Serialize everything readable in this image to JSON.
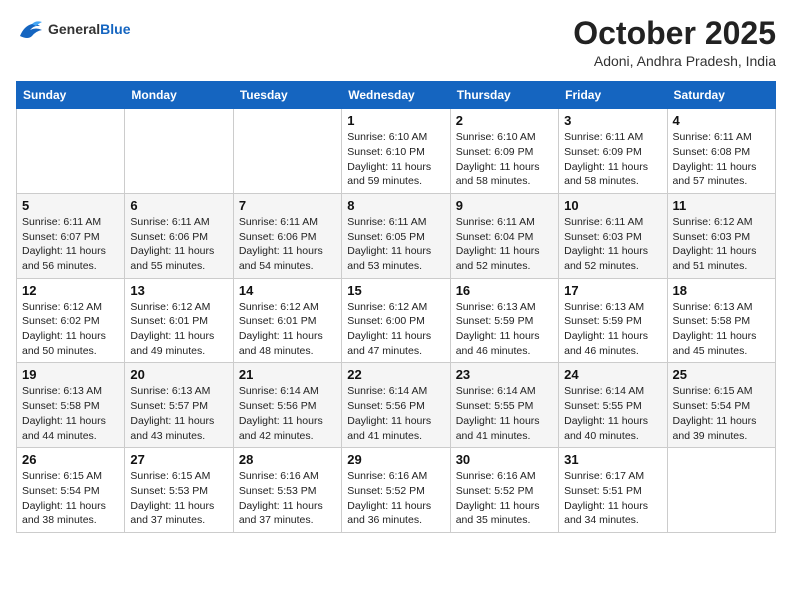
{
  "header": {
    "logo_general": "General",
    "logo_blue": "Blue",
    "month": "October 2025",
    "location": "Adoni, Andhra Pradesh, India"
  },
  "weekdays": [
    "Sunday",
    "Monday",
    "Tuesday",
    "Wednesday",
    "Thursday",
    "Friday",
    "Saturday"
  ],
  "weeks": [
    [
      {
        "day": "",
        "info": ""
      },
      {
        "day": "",
        "info": ""
      },
      {
        "day": "",
        "info": ""
      },
      {
        "day": "1",
        "info": "Sunrise: 6:10 AM\nSunset: 6:10 PM\nDaylight: 11 hours\nand 59 minutes."
      },
      {
        "day": "2",
        "info": "Sunrise: 6:10 AM\nSunset: 6:09 PM\nDaylight: 11 hours\nand 58 minutes."
      },
      {
        "day": "3",
        "info": "Sunrise: 6:11 AM\nSunset: 6:09 PM\nDaylight: 11 hours\nand 58 minutes."
      },
      {
        "day": "4",
        "info": "Sunrise: 6:11 AM\nSunset: 6:08 PM\nDaylight: 11 hours\nand 57 minutes."
      }
    ],
    [
      {
        "day": "5",
        "info": "Sunrise: 6:11 AM\nSunset: 6:07 PM\nDaylight: 11 hours\nand 56 minutes."
      },
      {
        "day": "6",
        "info": "Sunrise: 6:11 AM\nSunset: 6:06 PM\nDaylight: 11 hours\nand 55 minutes."
      },
      {
        "day": "7",
        "info": "Sunrise: 6:11 AM\nSunset: 6:06 PM\nDaylight: 11 hours\nand 54 minutes."
      },
      {
        "day": "8",
        "info": "Sunrise: 6:11 AM\nSunset: 6:05 PM\nDaylight: 11 hours\nand 53 minutes."
      },
      {
        "day": "9",
        "info": "Sunrise: 6:11 AM\nSunset: 6:04 PM\nDaylight: 11 hours\nand 52 minutes."
      },
      {
        "day": "10",
        "info": "Sunrise: 6:11 AM\nSunset: 6:03 PM\nDaylight: 11 hours\nand 52 minutes."
      },
      {
        "day": "11",
        "info": "Sunrise: 6:12 AM\nSunset: 6:03 PM\nDaylight: 11 hours\nand 51 minutes."
      }
    ],
    [
      {
        "day": "12",
        "info": "Sunrise: 6:12 AM\nSunset: 6:02 PM\nDaylight: 11 hours\nand 50 minutes."
      },
      {
        "day": "13",
        "info": "Sunrise: 6:12 AM\nSunset: 6:01 PM\nDaylight: 11 hours\nand 49 minutes."
      },
      {
        "day": "14",
        "info": "Sunrise: 6:12 AM\nSunset: 6:01 PM\nDaylight: 11 hours\nand 48 minutes."
      },
      {
        "day": "15",
        "info": "Sunrise: 6:12 AM\nSunset: 6:00 PM\nDaylight: 11 hours\nand 47 minutes."
      },
      {
        "day": "16",
        "info": "Sunrise: 6:13 AM\nSunset: 5:59 PM\nDaylight: 11 hours\nand 46 minutes."
      },
      {
        "day": "17",
        "info": "Sunrise: 6:13 AM\nSunset: 5:59 PM\nDaylight: 11 hours\nand 46 minutes."
      },
      {
        "day": "18",
        "info": "Sunrise: 6:13 AM\nSunset: 5:58 PM\nDaylight: 11 hours\nand 45 minutes."
      }
    ],
    [
      {
        "day": "19",
        "info": "Sunrise: 6:13 AM\nSunset: 5:58 PM\nDaylight: 11 hours\nand 44 minutes."
      },
      {
        "day": "20",
        "info": "Sunrise: 6:13 AM\nSunset: 5:57 PM\nDaylight: 11 hours\nand 43 minutes."
      },
      {
        "day": "21",
        "info": "Sunrise: 6:14 AM\nSunset: 5:56 PM\nDaylight: 11 hours\nand 42 minutes."
      },
      {
        "day": "22",
        "info": "Sunrise: 6:14 AM\nSunset: 5:56 PM\nDaylight: 11 hours\nand 41 minutes."
      },
      {
        "day": "23",
        "info": "Sunrise: 6:14 AM\nSunset: 5:55 PM\nDaylight: 11 hours\nand 41 minutes."
      },
      {
        "day": "24",
        "info": "Sunrise: 6:14 AM\nSunset: 5:55 PM\nDaylight: 11 hours\nand 40 minutes."
      },
      {
        "day": "25",
        "info": "Sunrise: 6:15 AM\nSunset: 5:54 PM\nDaylight: 11 hours\nand 39 minutes."
      }
    ],
    [
      {
        "day": "26",
        "info": "Sunrise: 6:15 AM\nSunset: 5:54 PM\nDaylight: 11 hours\nand 38 minutes."
      },
      {
        "day": "27",
        "info": "Sunrise: 6:15 AM\nSunset: 5:53 PM\nDaylight: 11 hours\nand 37 minutes."
      },
      {
        "day": "28",
        "info": "Sunrise: 6:16 AM\nSunset: 5:53 PM\nDaylight: 11 hours\nand 37 minutes."
      },
      {
        "day": "29",
        "info": "Sunrise: 6:16 AM\nSunset: 5:52 PM\nDaylight: 11 hours\nand 36 minutes."
      },
      {
        "day": "30",
        "info": "Sunrise: 6:16 AM\nSunset: 5:52 PM\nDaylight: 11 hours\nand 35 minutes."
      },
      {
        "day": "31",
        "info": "Sunrise: 6:17 AM\nSunset: 5:51 PM\nDaylight: 11 hours\nand 34 minutes."
      },
      {
        "day": "",
        "info": ""
      }
    ]
  ]
}
